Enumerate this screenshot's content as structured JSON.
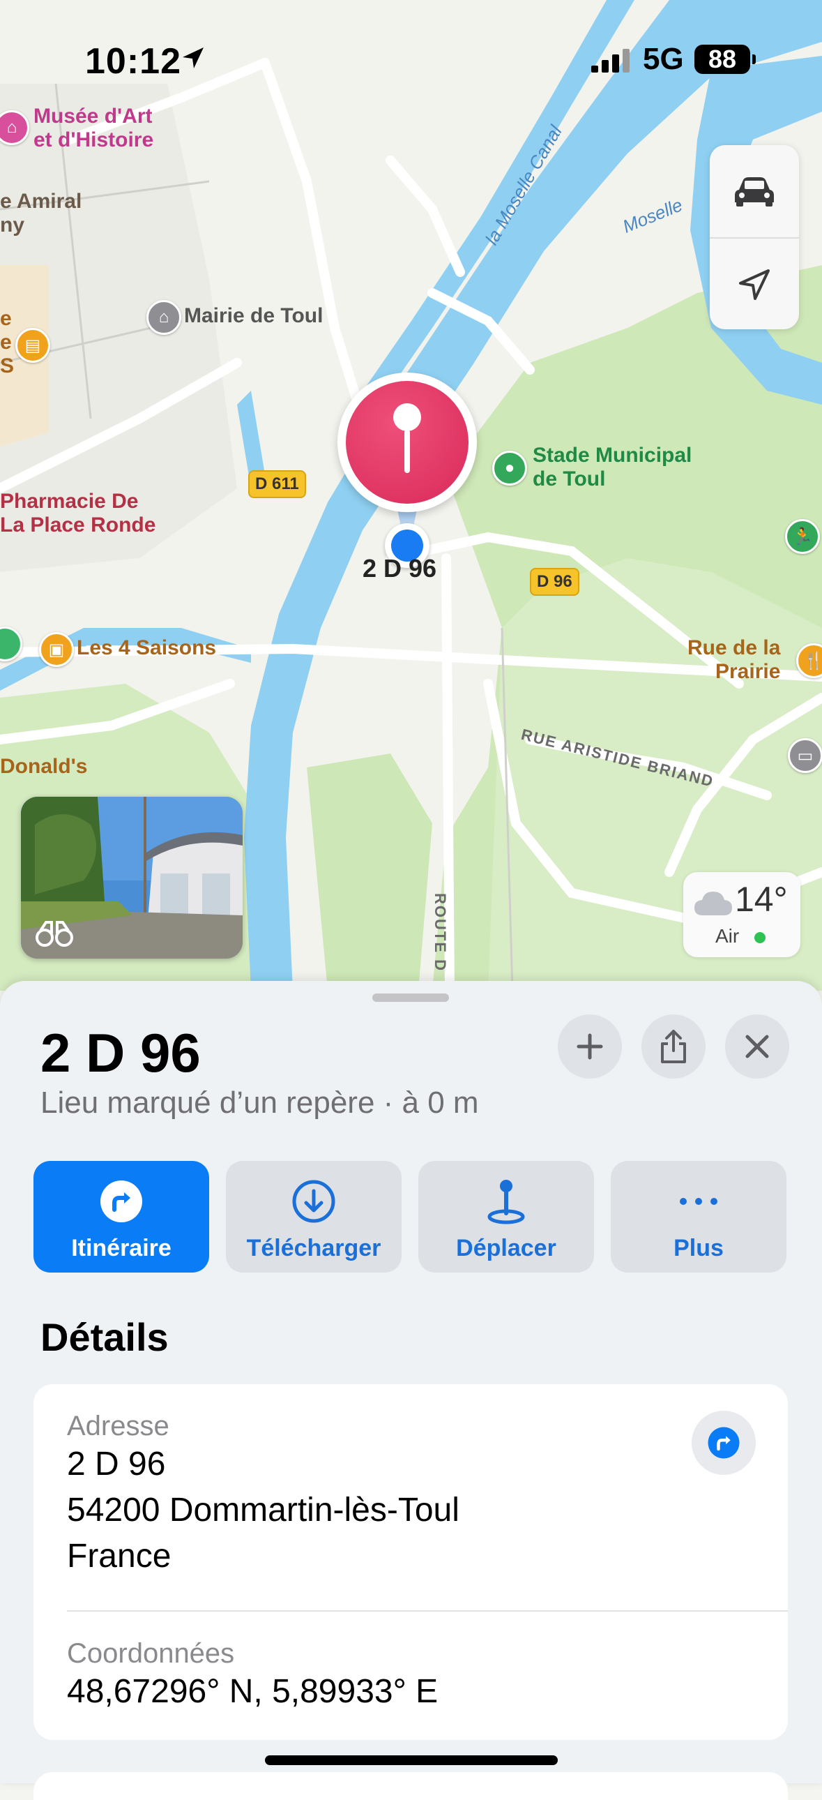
{
  "status_bar": {
    "time": "10:12",
    "network": "5G",
    "battery": "88"
  },
  "map": {
    "labels": {
      "musee_line1": "Musée d'Art",
      "musee_line2": "et d'Histoire",
      "amiral_line1": "e Amiral",
      "amiral_line2": "ny",
      "mairie": "Mairie de Toul",
      "left_e": "e",
      "left_e2": "e",
      "left_s": "S",
      "pharmacie_line1": "Pharmacie De",
      "pharmacie_line2": "La Place Ronde",
      "saisons": "Les 4 Saisons",
      "donalds": "Donald's",
      "stade_line1": "Stade Municipal",
      "stade_line2": "de Toul",
      "rue_prairie_line1": "Rue de la",
      "rue_prairie_line2": "Prairie",
      "rue_aristide": "RUE ARISTIDE BRIAND",
      "route_d": "ROUTE D",
      "moselle_canal": "la Moselle Canal",
      "moselle": "Moselle"
    },
    "shields": {
      "d611": "D 611",
      "d96": "D 96"
    },
    "pin_label": "2 D 96",
    "weather": {
      "temp": "14°",
      "air": "Air"
    },
    "icons": [
      "car-icon",
      "location-arrow-icon",
      "binoculars-icon",
      "cloud-icon"
    ]
  },
  "sheet": {
    "title": "2 D 96",
    "subtitle": "Lieu marqué d’un repère · à 0 m",
    "actions": [
      {
        "label": "Itinéraire",
        "icon": "directions-icon"
      },
      {
        "label": "Télécharger",
        "icon": "download-icon"
      },
      {
        "label": "Déplacer",
        "icon": "move-pin-icon"
      },
      {
        "label": "Plus",
        "icon": "more-icon"
      }
    ],
    "details_heading": "Détails",
    "address": {
      "label": "Adresse",
      "line1": "2 D 96",
      "line2": "54200 Dommartin-lès-Toul",
      "line3": "France"
    },
    "coordinates": {
      "label": "Coordonnées",
      "value": "48,67296° N, 5,89933° E"
    }
  },
  "colors": {
    "accent": "#0a7cf5",
    "pin": "#e0336a",
    "water": "#8fd0f2",
    "park": "#cde8b2"
  }
}
